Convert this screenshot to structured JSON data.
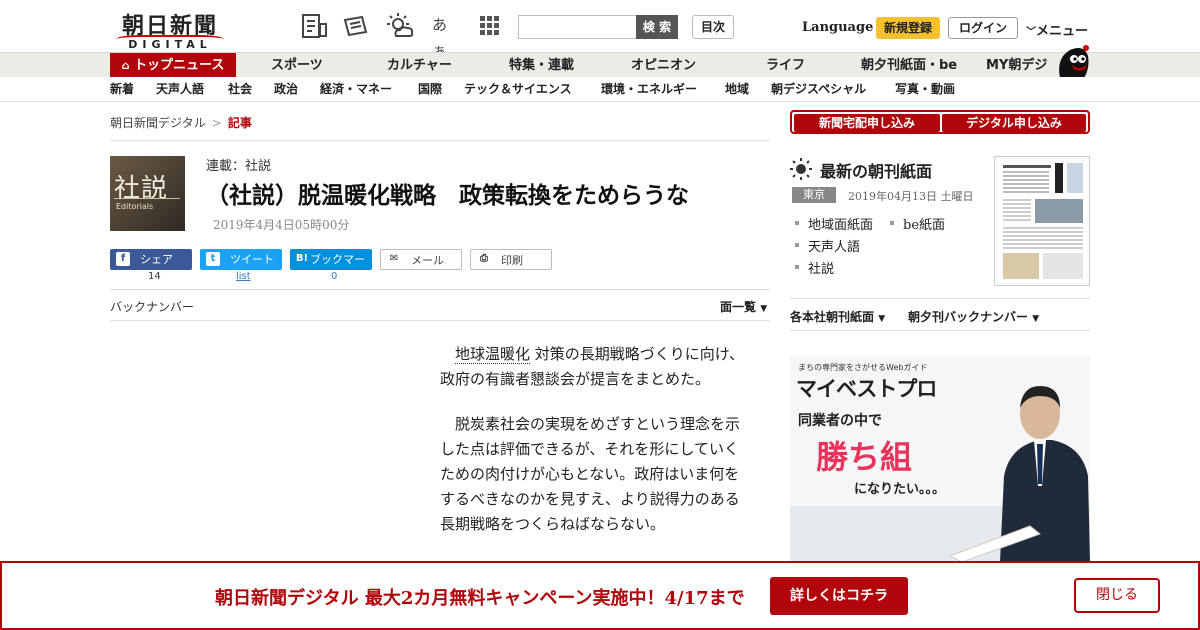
{
  "header": {
    "logo_main": "朝日新聞",
    "logo_sub": "DIGITAL",
    "icons": [
      "notes-icon",
      "newspaper-icon",
      "weather-icon",
      "font-size-icon",
      "grid-icon"
    ],
    "font_size_icon_text": "あぁ",
    "search_placeholder": "",
    "search_button": "検 索",
    "toc_button": "目次",
    "language_link": "Language",
    "register_button": "新規登録",
    "login_button": "ログイン",
    "menu_button": "メニュー"
  },
  "nav_primary": {
    "items": [
      "トップニュース",
      "スポーツ",
      "カルチャー",
      "特集・連載",
      "オピニオン",
      "ライフ",
      "朝夕刊紙面・be",
      "MY朝デジ"
    ]
  },
  "nav_secondary": {
    "items": [
      "新着",
      "天声人語",
      "社会",
      "政治",
      "経済・マネー",
      "国際",
      "テック＆サイエンス",
      "環境・エネルギー",
      "地域",
      "朝デジスペシャル",
      "写真・動画"
    ]
  },
  "breadcrumb": {
    "items": [
      "朝日新聞デジタル",
      "記事"
    ],
    "separator": ">"
  },
  "article": {
    "thumb_kanji": "社説",
    "thumb_english": "Editorials",
    "series": "連載：社説",
    "title": "（社説）脱温暖化戦略　政策転換をためらうな",
    "date": "2019年4月4日05時00分",
    "share": [
      {
        "label": "シェア",
        "icon": "f",
        "count": "14",
        "color": "#3b5998"
      },
      {
        "label": "ツイート",
        "icon": "t",
        "count": "list",
        "color": "#1da1f2"
      },
      {
        "label": "ブックマーク",
        "icon": "B!",
        "count": "0",
        "color": "#008fde"
      },
      {
        "label": "メール",
        "icon": "✉",
        "count": "",
        "color": "#ffffff"
      },
      {
        "label": "印刷",
        "icon": "⎙",
        "count": "",
        "color": "#ffffff"
      }
    ],
    "back_number": "バックナンバー",
    "page_list": "面一覧",
    "body_keyword": "地球温暖化",
    "body_p1_rest": "対策の長期戦略づくりに向け、政府の有識者懇談会が提言をまとめた。",
    "body_p2": "脱炭素社会の実現をめざすという理念を示した点は評価できるが、それを形にしていくための肉付けが心もとない。政府はいま何をするべきなのかを見すえ、より説得力のある長期戦略をつくらねばならない。"
  },
  "sidebar": {
    "subscribe_buttons": [
      "新聞宅配申し込み",
      "デジタル申し込み"
    ],
    "paper_title": "最新の朝刊紙面",
    "region": "東京",
    "paper_date": "2019年04月13日 土曜日",
    "paper_links": [
      "地域面紙面",
      "be紙面",
      "天声人語",
      "社説"
    ],
    "dropdowns": [
      "各本社朝刊紙面",
      "朝夕刊バックナンバー"
    ],
    "ad": {
      "tagline": "まちの専門家をさがせるWebガイド",
      "brand": "マイベストプロ",
      "line1": "同業者の中で",
      "line2": "勝ち組",
      "line3": "になりたい。。。"
    }
  },
  "banner": {
    "text": "朝日新聞デジタル 最大2カ月無料キャンペーン実施中！4/17まで",
    "button": "詳しくはコチラ",
    "close": "閉じる"
  },
  "colors": {
    "brand_red": "#b1050b",
    "register_yellow": "#f5c22e",
    "nav_bg": "#ecebe5"
  }
}
